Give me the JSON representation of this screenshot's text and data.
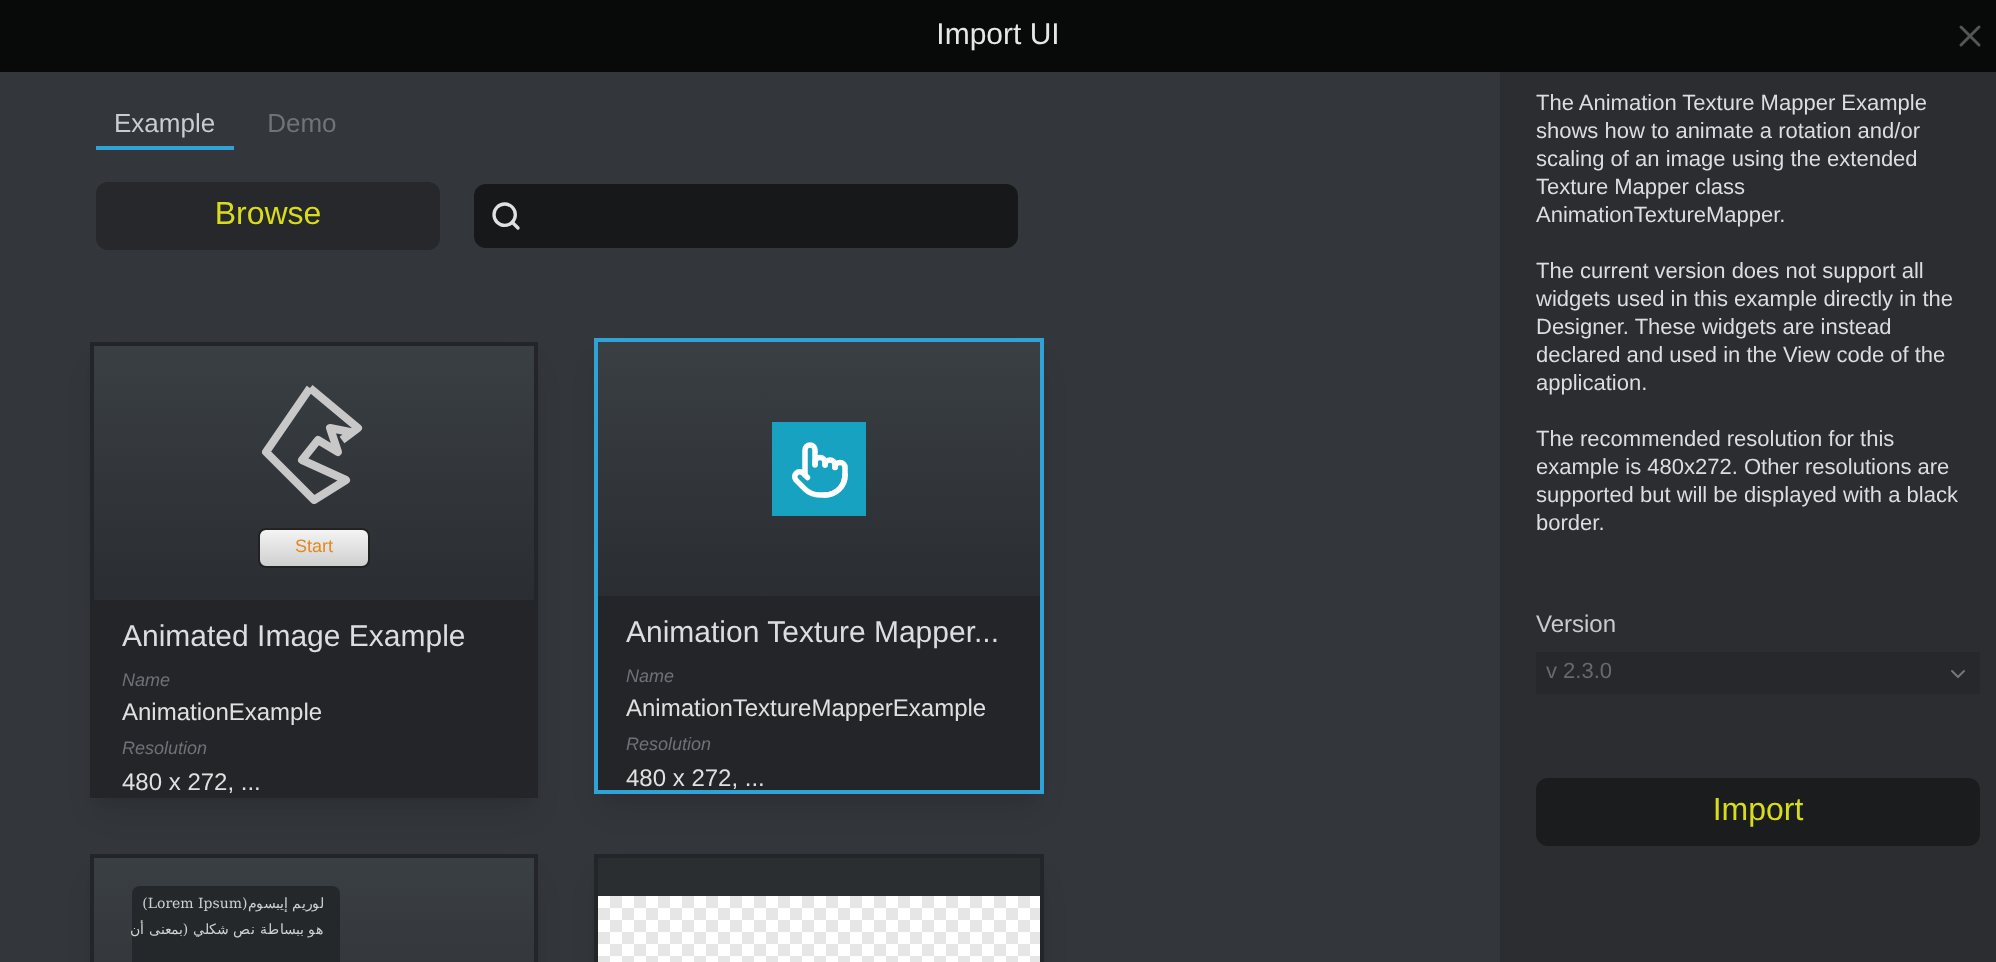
{
  "window": {
    "title": "Import UI"
  },
  "tabs": [
    {
      "label": "Example",
      "selected": true
    },
    {
      "label": "Demo",
      "selected": false
    }
  ],
  "browse_button": "Browse",
  "cards": [
    {
      "selected": false,
      "title": "Animated Image Example",
      "name_label": "Name",
      "name": "AnimationExample",
      "resolution_label": "Resolution",
      "resolution": "480 x 272, ...",
      "thumbnail": {
        "kind": "start",
        "button": "Start"
      }
    },
    {
      "selected": true,
      "title": "Animation Texture Mapper...",
      "name_label": "Name",
      "name": "AnimationTextureMapperExample",
      "resolution_label": "Resolution",
      "resolution": "480 x 272, ...",
      "thumbnail": {
        "kind": "touch"
      }
    },
    {
      "selected": false,
      "thumbnail": {
        "kind": "text",
        "lines": [
          "لوريم إيبسوم(Lorem Ipsum)",
          "هو ببساطة نص شكلي (بمعنى أن"
        ]
      }
    },
    {
      "selected": false,
      "thumbnail": {
        "kind": "transparent"
      }
    }
  ],
  "description": [
    "The Animation Texture Mapper Example shows how to animate a rotation and/or scaling of an image using the extended Texture Mapper class AnimationTextureMapper.",
    "The current version does not support all widgets used in this example directly in the Designer. These widgets are instead declared and used in the View code of the application.",
    "The recommended resolution for this example is 480x272. Other resolutions are supported but will be displayed with a black border."
  ],
  "version": {
    "label": "Version",
    "value": "v 2.3.0"
  },
  "import_button": "Import"
}
